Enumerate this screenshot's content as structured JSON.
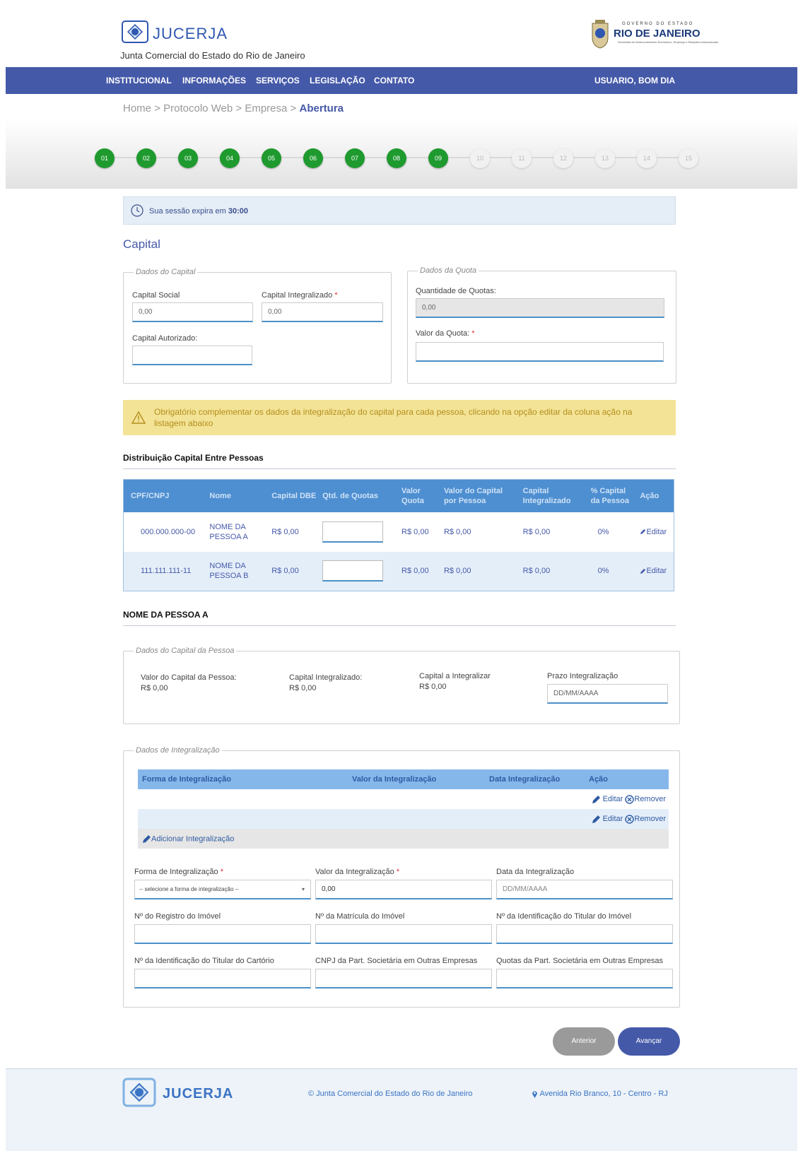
{
  "header": {
    "brand": "JUCERJA",
    "subtitle": "Junta Comercial do Estado do Rio de Janeiro",
    "gov_label": "GOVERNO DO ESTADO",
    "gov_name": "RIO DE JANEIRO",
    "gov_secretariat": "Secretaria de Desenvolvimento Econômico, Emprego e Relações Internacionais"
  },
  "nav": {
    "items": [
      "INSTITUCIONAL",
      "INFORMAÇÕES",
      "SERVIÇOS",
      "LEGISLAÇÃO",
      "CONTATO"
    ],
    "user": "USUARIO, BOM DIA"
  },
  "breadcrumb": {
    "home": "Home",
    "protocolo": "Protocolo Web",
    "empresa": "Empresa",
    "current": "Abertura",
    "sep": ">"
  },
  "steps": {
    "labels": [
      "01",
      "02",
      "03",
      "04",
      "05",
      "06",
      "07",
      "08",
      "09",
      "10",
      "11",
      "12",
      "13",
      "14",
      "15"
    ],
    "completed": 9
  },
  "session": {
    "text": "Sua sessão expira em",
    "time": "30:00"
  },
  "capital": {
    "title": "Capital",
    "dados_capital": {
      "legend": "Dados do Capital",
      "capital_social_label": "Capital Social",
      "capital_social_value": "0,00",
      "capital_integralizado_label": "Capital Integralizado",
      "capital_integralizado_value": "0,00",
      "capital_autorizado_label": "Capital Autorizado:",
      "capital_autorizado_value": ""
    },
    "dados_quota": {
      "legend": "Dados da Quota",
      "quantidade_label": "Quantidade de Quotas:",
      "quantidade_value": "0,00",
      "valor_label": "Valor da Quota:",
      "valor_value": ""
    }
  },
  "warning": {
    "text": "Obrigatório complementar os dados da integralização do capital para cada pessoa, clicando na opção editar da coluna ação na listagem abaixo"
  },
  "distribuicao": {
    "title": "Distribuição Capital Entre Pessoas",
    "headers": [
      "CPF/CNPJ",
      "Nome",
      "Capital DBE",
      "Qtd. de Quotas",
      "Valor Quota",
      "Valor do Capital por Pessoa",
      "Capital Integralizado",
      "% Capital da Pessoa",
      "Ação"
    ],
    "rows": [
      {
        "cpf": "000.000.000-00",
        "nome": "NOME DA PESSOA A",
        "capital_dbe": "R$ 0,00",
        "valor_quota": "R$ 0,00",
        "valor_capital": "R$ 0,00",
        "integralizado": "R$ 0,00",
        "percent": "0%",
        "acao": "Editar"
      },
      {
        "cpf": "111.111.111-11",
        "nome": "NOME DA PESSOA B",
        "capital_dbe": "R$ 0,00",
        "valor_quota": "R$ 0,00",
        "valor_capital": "R$ 0,00",
        "integralizado": "R$ 0,00",
        "percent": "0%",
        "acao": "Editar"
      }
    ]
  },
  "pessoa": {
    "title": "NOME DA PESSOA A",
    "legend": "Dados do Capital da Pessoa",
    "valor_label": "Valor do Capital da Pessoa:",
    "valor_value": "R$ 0,00",
    "integralizado_label": "Capital Integralizado:",
    "integralizado_value": "R$ 0,00",
    "a_integralizar_label": "Capital a Integralizar",
    "a_integralizar_value": "R$ 0,00",
    "prazo_label": "Prazo Integralização",
    "prazo_placeholder": "DD/MM/AAAA"
  },
  "integralizacao": {
    "legend": "Dados de Integralização",
    "headers": [
      "Forma de Integralização",
      "Valor da Integralização",
      "Data Integralização",
      "Ação"
    ],
    "editar": "Editar",
    "remover": "Remover",
    "adicionar": "Adicionar Integralização",
    "forma_label": "Forma de Integralização",
    "forma_value": "-- selecione a forma de integralização --",
    "valor_label": "Valor da Integralização",
    "valor_value": "0,00",
    "data_label": "Data da Integralização",
    "data_placeholder": "DD/MM/AAAA",
    "registro_label": "Nº do Registro do Imóvel",
    "matricula_label": "Nº da Matrícula do Imóvel",
    "titular_imovel_label": "Nº da Identificação do Titular do Imóvel",
    "titular_cartorio_label": "Nº da Identificação do Titular do Cartório",
    "cnpj_part_label": "CNPJ da Part. Societária em Outras Empresas",
    "quotas_part_label": "Quotas da Part. Societária em Outras Empresas"
  },
  "buttons": {
    "anterior": "Anterior",
    "avancar": "Avançar"
  },
  "footer": {
    "brand": "JUCERJA",
    "copyright": "© Junta Comercial do Estado do Rio de Janeiro",
    "address": "Avenida Rio Branco, 10 - Centro - RJ"
  },
  "colors": {
    "primary": "#4559a9",
    "step_done": "#1e9a2e",
    "table_header": "#4e8fd1",
    "warning_bg": "#f3e396"
  }
}
